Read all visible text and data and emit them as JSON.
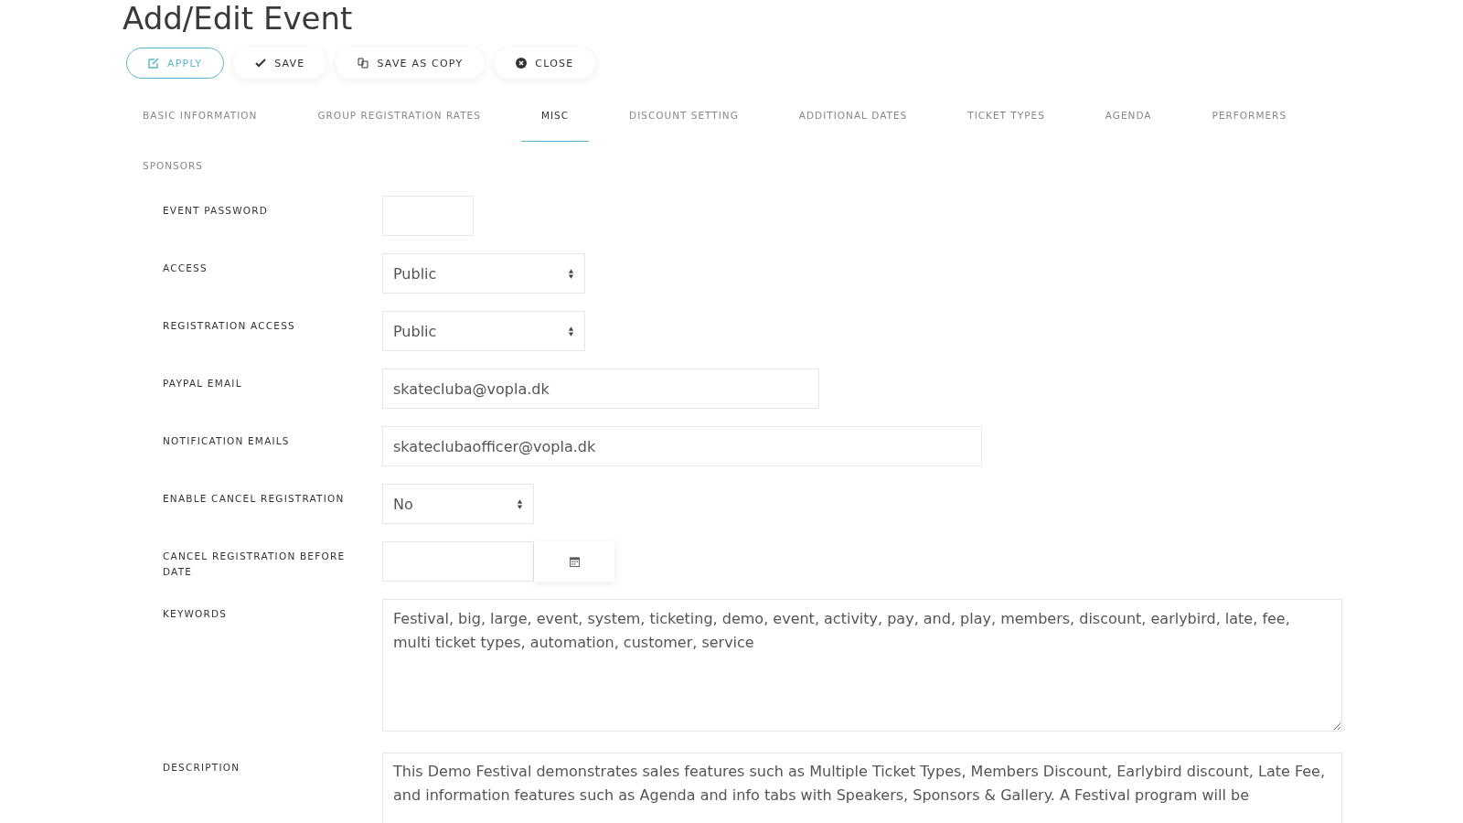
{
  "page_title": "Add/Edit Event",
  "toolbar": [
    {
      "label": "APPLY",
      "kind": "apply",
      "selected": true
    },
    {
      "label": "SAVE",
      "kind": "save",
      "selected": false
    },
    {
      "label": "SAVE AS COPY",
      "kind": "copy",
      "selected": false
    },
    {
      "label": "CLOSE",
      "kind": "close",
      "selected": false
    }
  ],
  "tabs": [
    {
      "label": "BASIC INFORMATION",
      "selected": false
    },
    {
      "label": "GROUP REGISTRATION RATES",
      "selected": false
    },
    {
      "label": "MISC",
      "selected": true
    },
    {
      "label": "DISCOUNT SETTING",
      "selected": false
    },
    {
      "label": "ADDITIONAL DATES",
      "selected": false
    },
    {
      "label": "TICKET TYPES",
      "selected": false
    },
    {
      "label": "AGENDA",
      "selected": false
    },
    {
      "label": "PERFORMERS",
      "selected": false
    },
    {
      "label": "SPONSORS",
      "selected": false
    }
  ],
  "fields": [
    {
      "label": "EVENT PASSWORD",
      "kind": "text"
    },
    {
      "label": "ACCESS",
      "kind": "select",
      "value": "Public"
    },
    {
      "label": "REGISTRATION ACCESS",
      "kind": "select",
      "value": "Public"
    },
    {
      "label": "PAYPAL EMAIL",
      "kind": "text",
      "value": "skatecluba@vopla.dk"
    },
    {
      "label": "NOTIFICATION EMAILS",
      "kind": "text",
      "value": "skateclubaofficer@vopla.dk"
    },
    {
      "label": "ENABLE CANCEL REGISTRATION",
      "kind": "select",
      "value": "No"
    },
    {
      "label": "CANCEL REGISTRATION BEFORE DATE",
      "kind": "date"
    },
    {
      "label": "KEYWORDS",
      "kind": "textarea",
      "value": "Festival, big, large, event, system, ticketing, demo, event, activity, pay, and, play, members, discount, earlybird, late, fee, multi ticket types, automation, customer, service"
    },
    {
      "label": "DESCRIPTION",
      "kind": "editor",
      "value": "This Demo Festival demonstrates sales features such as Multiple Ticket Types, Members Discount, Earlybird discount, Late Fee, and information features such as Agenda and info tabs with Speakers,  Sponsors & Gallery. A Festival program will be"
    }
  ]
}
